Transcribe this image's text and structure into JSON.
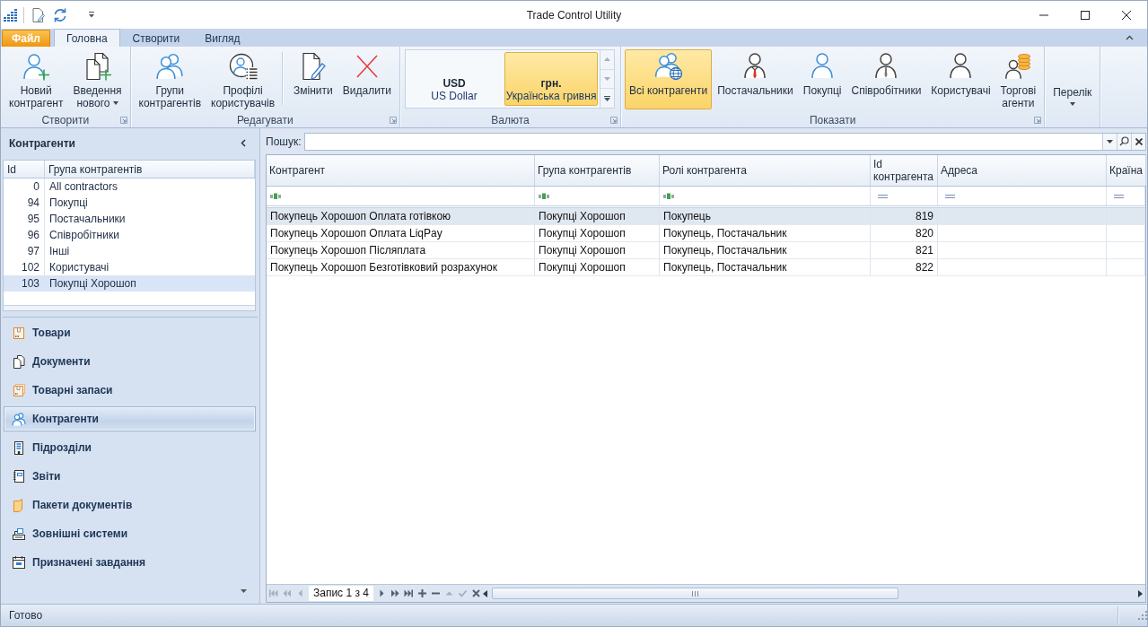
{
  "window": {
    "title": "Trade Control Utility"
  },
  "ribbon": {
    "tabs": [
      {
        "label": "Файл",
        "kind": "file",
        "selected": false
      },
      {
        "label": "Головна",
        "kind": "tab",
        "selected": true
      },
      {
        "label": "Створити",
        "kind": "tab",
        "selected": false
      },
      {
        "label": "Вигляд",
        "kind": "tab",
        "selected": false
      }
    ],
    "groups": [
      {
        "label": "Створити",
        "kind": "buttons",
        "dialog_launcher": true,
        "items": [
          {
            "label": "Новий\nконтрагент",
            "dropdown": false,
            "selected": false,
            "separator_before": false
          },
          {
            "label": "Введення\nнового",
            "dropdown": true,
            "selected": false,
            "separator_before": false
          }
        ]
      },
      {
        "label": "Редагувати",
        "kind": "buttons",
        "dialog_launcher": true,
        "items": [
          {
            "label": "Групи\nконтрагентів",
            "dropdown": false,
            "selected": false,
            "separator_before": false
          },
          {
            "label": "Профілі\nкористувачів",
            "dropdown": false,
            "selected": false,
            "separator_before": false
          },
          {
            "label": "Змінити",
            "dropdown": false,
            "selected": false,
            "separator_before": true
          },
          {
            "label": "Видалити",
            "dropdown": false,
            "selected": false,
            "separator_before": false
          }
        ]
      },
      {
        "label": "Валюта",
        "kind": "gallery",
        "dialog_launcher": true,
        "items": [
          {
            "code": "USD",
            "name": "US Dollar",
            "selected": false
          },
          {
            "code": "грн.",
            "name": "Українська гривня",
            "selected": true
          }
        ]
      },
      {
        "label": "Показати",
        "kind": "buttons",
        "dialog_launcher": true,
        "items": [
          {
            "label": "Всі контрагенти",
            "dropdown": false,
            "selected": true,
            "separator_before": false
          },
          {
            "label": "Постачальники",
            "dropdown": false,
            "selected": false,
            "separator_before": false
          },
          {
            "label": "Покупці",
            "dropdown": false,
            "selected": false,
            "separator_before": false
          },
          {
            "label": "Співробітники",
            "dropdown": false,
            "selected": false,
            "separator_before": false
          },
          {
            "label": "Користувачі",
            "dropdown": false,
            "selected": false,
            "separator_before": false
          },
          {
            "label": "Торгові\nагенти",
            "dropdown": false,
            "selected": false,
            "separator_before": false
          }
        ]
      },
      {
        "kind": "buttons",
        "dialog_launcher": false,
        "items": [
          {
            "label": "Перелік",
            "dropdown": true,
            "selected": false,
            "separator_before": false
          }
        ]
      }
    ]
  },
  "left_panel": {
    "title": "Контрагенти",
    "groups_table": {
      "columns": [
        "Id",
        "Група контрагентів"
      ],
      "rows": [
        {
          "id": "0",
          "name": "All contractors",
          "selected": false
        },
        {
          "id": "94",
          "name": "Покупці",
          "selected": false
        },
        {
          "id": "95",
          "name": "Постачальники",
          "selected": false
        },
        {
          "id": "96",
          "name": "Співробітники",
          "selected": false
        },
        {
          "id": "97",
          "name": "Інші",
          "selected": false
        },
        {
          "id": "102",
          "name": "Користувачі",
          "selected": false
        },
        {
          "id": "103",
          "name": "Покупці Хорошоп",
          "selected": true
        }
      ]
    },
    "nav": [
      {
        "label": "Товари",
        "selected": false
      },
      {
        "label": "Документи",
        "selected": false
      },
      {
        "label": "Товарні запаси",
        "selected": false
      },
      {
        "label": "Контрагенти",
        "selected": true
      },
      {
        "label": "Підрозділи",
        "selected": false
      },
      {
        "label": "Звіти",
        "selected": false
      },
      {
        "label": "Пакети документів",
        "selected": false
      },
      {
        "label": "Зовнішні системи",
        "selected": false
      },
      {
        "label": "Призначені завдання",
        "selected": false
      }
    ]
  },
  "search": {
    "label": "Пошук:"
  },
  "table": {
    "columns": [
      {
        "label": "Контрагент",
        "kind": "text"
      },
      {
        "label": "Група контрагентів",
        "kind": "text"
      },
      {
        "label": "Ролі контрагента",
        "kind": "text"
      },
      {
        "label": "Id контрагента",
        "kind": "number"
      },
      {
        "label": "Адреса",
        "kind": "lookup"
      },
      {
        "label": "Країна",
        "kind": "lookup"
      }
    ],
    "rows": [
      {
        "cells": [
          "Покупець Хорошоп Оплата готівкою",
          "Покупці Хорошоп",
          "Покупець",
          "819"
        ],
        "selected": true
      },
      {
        "cells": [
          "Покупець Хорошоп Оплата LiqPay",
          "Покупці Хорошоп",
          "Покупець, Постачальник",
          "820"
        ],
        "selected": false
      },
      {
        "cells": [
          "Покупець Хорошоп Післяплата",
          "Покупці Хорошоп",
          "Покупець, Постачальник",
          "821"
        ],
        "selected": false
      },
      {
        "cells": [
          "Покупець Хорошоп Безготівковий розрахунок",
          "Покупці Хорошоп",
          "Покупець, Постачальник",
          "822"
        ],
        "selected": false
      }
    ],
    "navigator": {
      "label": "Запис 1 з 4",
      "back_buttons": [
        {
          "kind": "first",
          "disabled": true
        },
        {
          "kind": "prev_page",
          "disabled": true
        },
        {
          "kind": "prev",
          "disabled": true
        }
      ],
      "forward_buttons": [
        {
          "kind": "next",
          "disabled": false
        },
        {
          "kind": "next_page",
          "disabled": false
        },
        {
          "kind": "last",
          "disabled": false
        },
        {
          "kind": "append",
          "disabled": false
        },
        {
          "kind": "remove",
          "disabled": false
        },
        {
          "kind": "edit",
          "disabled": true
        },
        {
          "kind": "end_edit",
          "disabled": true
        },
        {
          "kind": "cancel_edit",
          "disabled": false
        }
      ]
    }
  },
  "status_bar": {
    "text": "Готово"
  }
}
